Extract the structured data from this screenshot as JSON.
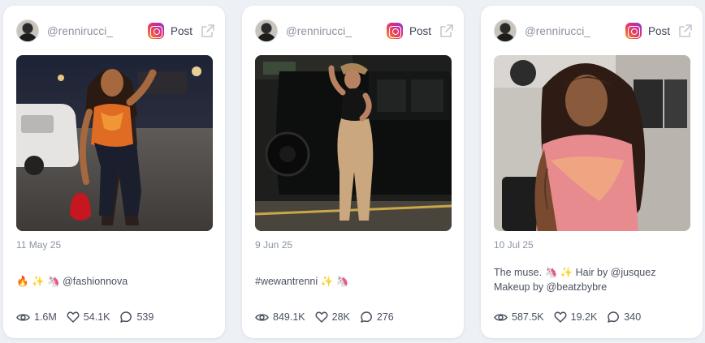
{
  "posts": [
    {
      "handle": "@rennirucci_",
      "platform_label": "Post",
      "date": "11 May 25",
      "caption": "🔥 ✨ 🦄 @fashionnova",
      "views": "1.6M",
      "likes": "54.1K",
      "comments": "539",
      "photo_desc": "night parking lot, orange halter top, dark jeans, red bag"
    },
    {
      "handle": "@rennirucci_",
      "platform_label": "Post",
      "date": "9 Jun 25",
      "caption": "#wewantrenni ✨ 🦄",
      "views": "849.1K",
      "likes": "28K",
      "comments": "276",
      "photo_desc": "cowboy hat, black top, tan pants, black SUV"
    },
    {
      "handle": "@rennirucci_",
      "platform_label": "Post",
      "date": "10 Jul 25",
      "caption_line1": "The muse. 🦄 ✨ Hair by @jusquez",
      "caption_line2": "Makeup by @beatzbybre",
      "views": "587.5K",
      "likes": "19.2K",
      "comments": "340",
      "photo_desc": "long curly hair, pink patterned top, salon interior"
    }
  ],
  "icons": {
    "avatar": "profile-avatar",
    "platform": "instagram-icon",
    "external": "external-link-icon",
    "views": "eye-icon",
    "likes": "heart-icon",
    "comments": "comment-bubble-icon"
  },
  "colors": {
    "background": "#edf0f5",
    "card": "#ffffff",
    "muted_text": "#8b93a3",
    "body_text": "#4a5160"
  }
}
